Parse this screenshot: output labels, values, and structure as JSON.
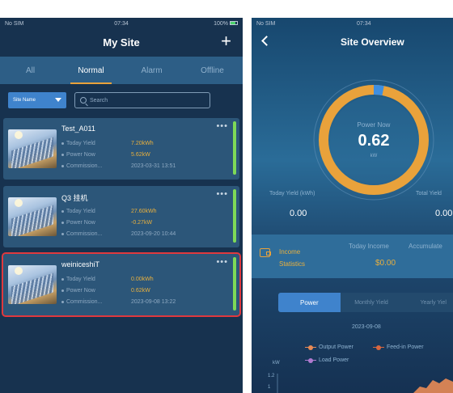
{
  "left": {
    "status": {
      "carrier": "No SIM",
      "time": "07:34",
      "battery": "100%"
    },
    "title": "My Site",
    "add_icon": "plus-icon",
    "tabs": [
      {
        "label": "All",
        "active": false
      },
      {
        "label": "Normal",
        "active": true
      },
      {
        "label": "Alarm",
        "active": false
      },
      {
        "label": "Offline",
        "active": false
      }
    ],
    "filter": {
      "select_value": "Site Name",
      "search_placeholder": "Search"
    },
    "row_labels": {
      "yield": "Today Yield",
      "power": "Power Now",
      "commission": "Commission..."
    },
    "sites": [
      {
        "name": "Test_A011",
        "today_yield": "7.20kWh",
        "power_now": "5.62kW",
        "commission": "2023-03-31 13:51",
        "selected": false
      },
      {
        "name": "Q3 挂机",
        "today_yield": "27.60kWh",
        "power_now": "-0.27kW",
        "commission": "2023-09-20 10:44",
        "selected": false
      },
      {
        "name": "weiniceshiT",
        "today_yield": "0.00kWh",
        "power_now": "0.62kW",
        "commission": "2023-09-08 13:22",
        "selected": true
      }
    ],
    "colors": {
      "status_bar": "#7ed957",
      "accent": "#e9a23b",
      "selection": "#e0393e"
    }
  },
  "right": {
    "status": {
      "carrier": "No SIM",
      "time": "07:34"
    },
    "title": "Site Overview",
    "gauge": {
      "label": "Power Now",
      "value": "0.62",
      "unit": "kW",
      "fraction": 0.03
    },
    "today_yield": {
      "label": "Today Yield (kWh)",
      "value": "0.00"
    },
    "total_yield": {
      "label": "Total Yield",
      "value": "0.00"
    },
    "income": {
      "title_line1": "Income",
      "title_line2": "Statistics",
      "today_label": "Today Income",
      "today_value": "$0.00",
      "accumulated_label": "Accumulate"
    },
    "segments": [
      {
        "label": "Power",
        "active": true
      },
      {
        "label": "Monthly Yield",
        "active": false
      },
      {
        "label": "Yearly Yiel",
        "active": false
      }
    ],
    "chart": {
      "date": "2023-09-08",
      "legend": [
        "Output Power",
        "Feed-in Power",
        "Load Power"
      ],
      "unit": "kW",
      "ticks": [
        "1.2",
        "1"
      ]
    }
  }
}
